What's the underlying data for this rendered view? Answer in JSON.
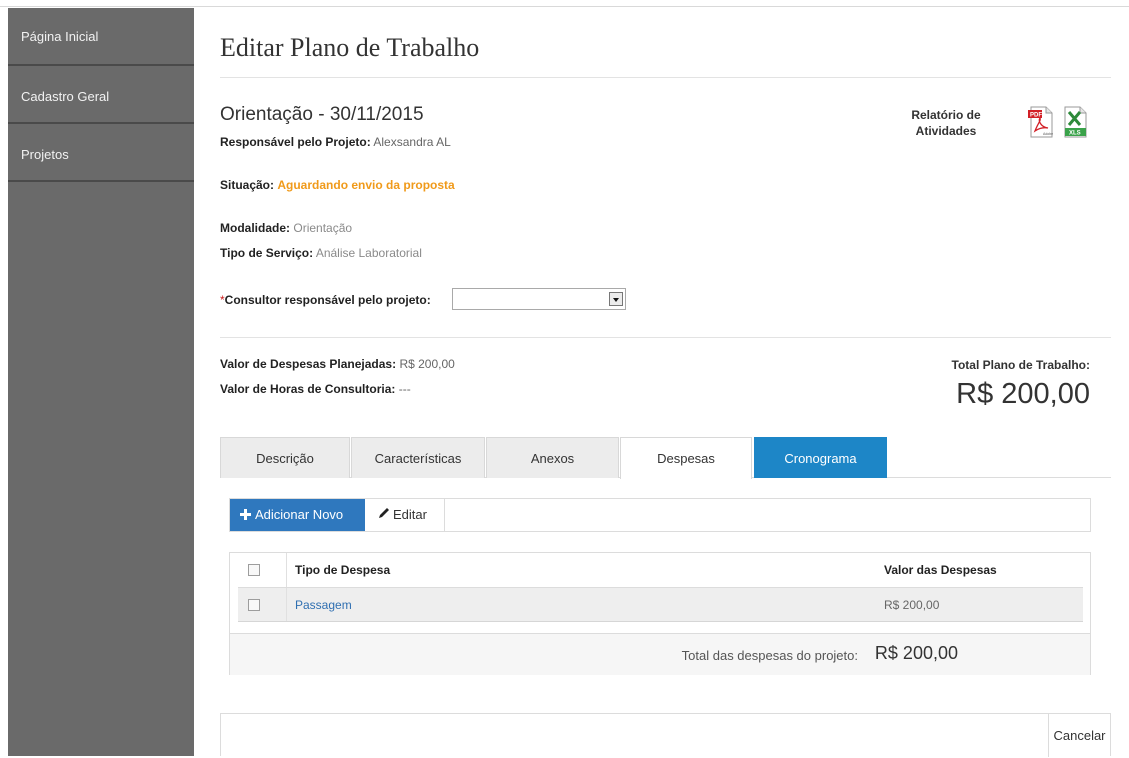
{
  "sidebar": {
    "items": [
      {
        "label": "Página Inicial"
      },
      {
        "label": "Cadastro Geral"
      },
      {
        "label": "Projetos"
      }
    ]
  },
  "page": {
    "title": "Editar Plano de Trabalho"
  },
  "project": {
    "title": "Orientação - 30/11/2015",
    "responsible_label": "Responsável pelo Projeto:",
    "responsible_value": "Alexsandra AL",
    "status_label": "Situação:",
    "status_value": "Aguardando envio da proposta",
    "modality_label": "Modalidade:",
    "modality_value": "Orientação",
    "service_label": "Tipo de Serviço:",
    "service_value": "Análise Laboratorial",
    "consultant_required": "*",
    "consultant_label": "Consultor responsável pelo projeto:",
    "consultant_value": ""
  },
  "report": {
    "label_line1": "Relatório de",
    "label_line2": "Atividades",
    "pdf_icon": "pdf-icon",
    "xls_icon": "xls-icon",
    "pdf_text": "PDF",
    "pdf_sub": "Adobe",
    "xls_text": "XLS"
  },
  "values": {
    "planned_label": "Valor de Despesas Planejadas:",
    "planned_value": "R$ 200,00",
    "hours_label": "Valor de Horas de Consultoria:",
    "hours_value": "---",
    "total_label": "Total Plano de Trabalho:",
    "total_value": "R$ 200,00"
  },
  "tabs": [
    {
      "label": "Descrição"
    },
    {
      "label": "Características"
    },
    {
      "label": "Anexos"
    },
    {
      "label": "Despesas"
    },
    {
      "label": "Cronograma"
    }
  ],
  "toolbar": {
    "add_label": "Adicionar Novo",
    "edit_label": "Editar"
  },
  "table": {
    "columns": [
      "Tipo de Despesa",
      "Valor das Despesas"
    ],
    "rows": [
      {
        "type": "Passagem",
        "value": "R$ 200,00"
      }
    ],
    "footer_label": "Total das despesas do projeto:",
    "footer_value": "R$ 200,00"
  },
  "actions": {
    "cancel_label": "Cancelar"
  },
  "colors": {
    "sidebar": "#6a6a6a",
    "status": "#f09a1a",
    "primary": "#2f78be",
    "tab_blue": "#1d86c7"
  }
}
